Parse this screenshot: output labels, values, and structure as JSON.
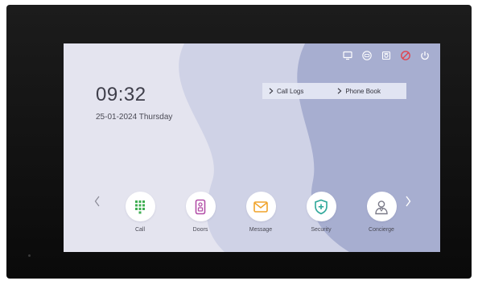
{
  "status_bar": {
    "icons": [
      "monitor-icon",
      "record-icon",
      "alarm-icon",
      "do-not-disturb-icon",
      "power-icon"
    ],
    "dnd_color": "#e0444f"
  },
  "home": {
    "time": "09:32",
    "date": "25-01-2024 Thursday"
  },
  "quick_links": [
    {
      "label": "Call Logs",
      "icon": "chevron-right-icon"
    },
    {
      "label": "Phone Book",
      "icon": "chevron-right-icon"
    }
  ],
  "apps": [
    {
      "label": "Call",
      "icon": "keypad-icon",
      "color": "#3fae52"
    },
    {
      "label": "Doors",
      "icon": "door-station-icon",
      "color": "#b34fa8"
    },
    {
      "label": "Message",
      "icon": "envelope-icon",
      "color": "#f0a32a"
    },
    {
      "label": "Security",
      "icon": "shield-plus-icon",
      "color": "#2fa89a"
    },
    {
      "label": "Concierge",
      "icon": "concierge-person-icon",
      "color": "#7a7a88"
    }
  ],
  "colors": {
    "screen_bg": "#e4e4ef",
    "wave_light": "#cfd2e6",
    "wave_dark": "#a7aed0",
    "bezel": "#111111"
  }
}
